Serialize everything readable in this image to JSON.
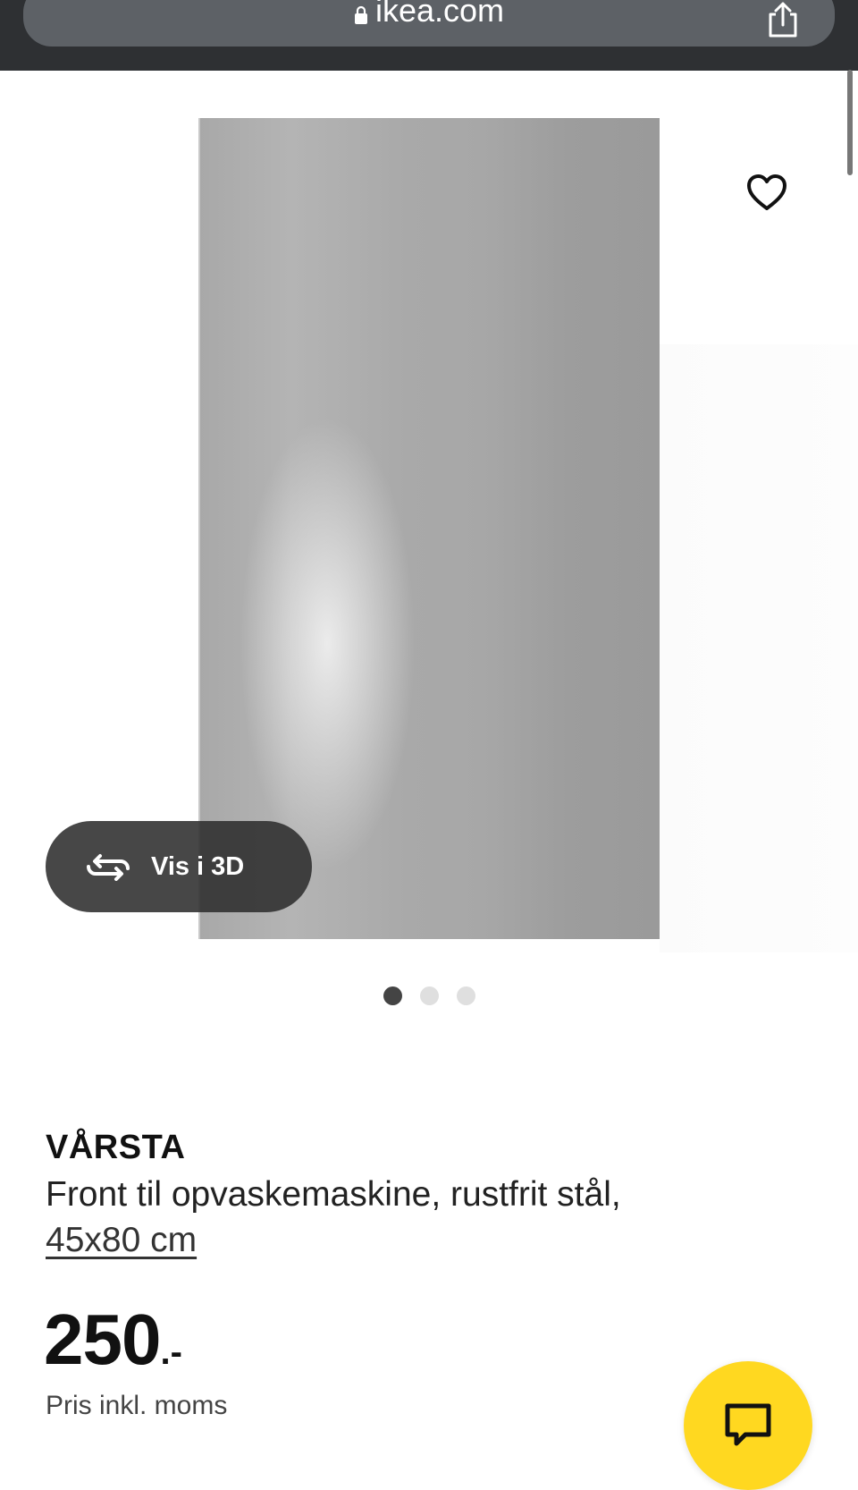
{
  "browser": {
    "url": "ikea.com",
    "lock_icon": "lock-icon",
    "share_icon": "share-icon"
  },
  "gallery": {
    "favorite_icon": "heart-icon",
    "view3d_label": "Vis i 3D",
    "view3d_icon": "rotate-3d-icon",
    "dots_count": 3,
    "active_dot": 0
  },
  "product": {
    "name": "VÅRSTA",
    "description": "Front til opvaskemaskine, rustfrit stål,",
    "size": "45x80 cm",
    "price_integer": "250",
    "price_suffix": ".-",
    "price_note": "Pris inkl. moms"
  },
  "chat": {
    "icon": "chat-icon",
    "color": "#FFD820"
  },
  "colors": {
    "browser_bar": "#2E3033",
    "url_pill": "#5D6166",
    "panel_gray": "#A8A8A8",
    "view3d_bg": "#2D2D2D"
  }
}
